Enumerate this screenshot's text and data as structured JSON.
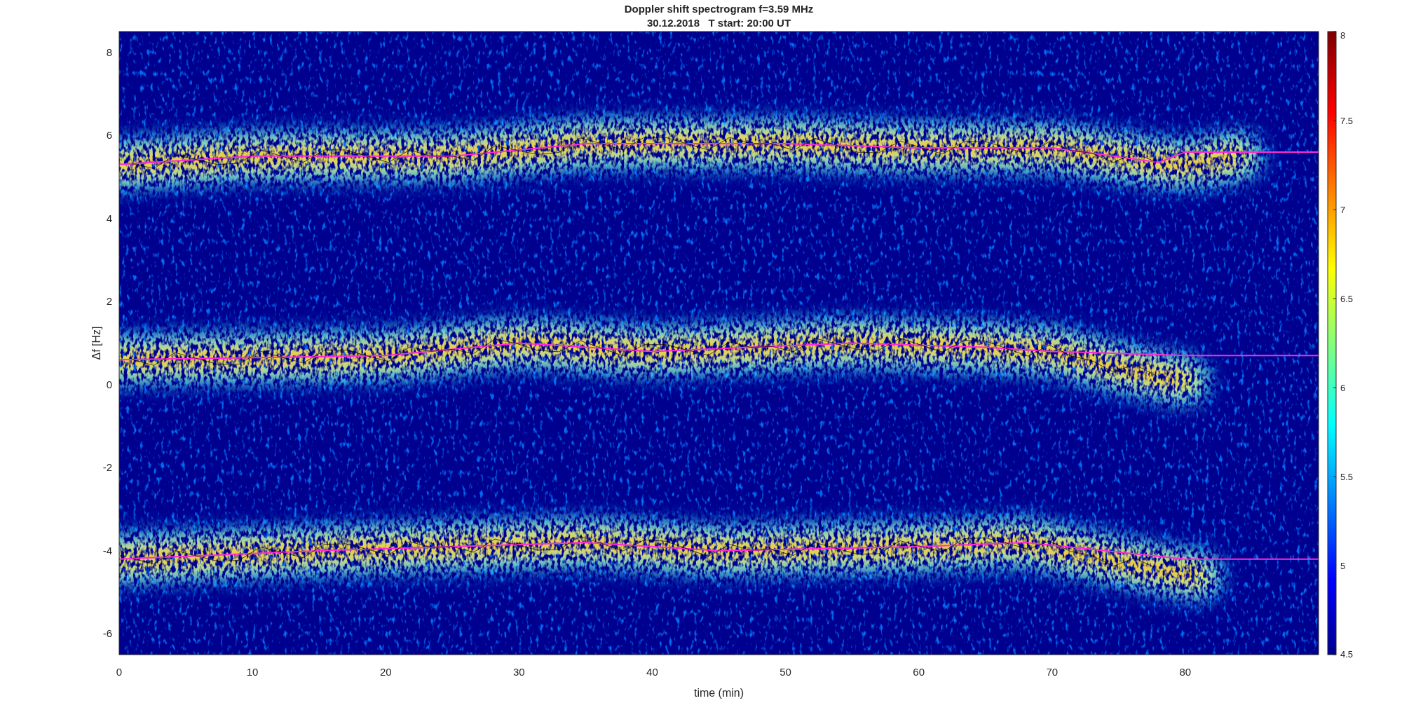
{
  "figure": {
    "title": [
      "Doppler shift spectrogram f=3.59 MHz",
      "30.12.2018   T start: 20:00 UT"
    ],
    "axes": {
      "xlabel": "time (min)",
      "ylabel": "Δf [Hz]",
      "xticks": [
        "0",
        "10",
        "20",
        "30",
        "40",
        "50",
        "60",
        "70",
        "80"
      ],
      "yticks": [
        "8",
        "6",
        "4",
        "2",
        "0",
        "-2",
        "-4",
        "-6"
      ]
    },
    "colorbar": {
      "ticks": [
        "8",
        "7.5",
        "7",
        "6.5",
        "6",
        "5.5",
        "5",
        "4.5"
      ]
    }
  }
}
